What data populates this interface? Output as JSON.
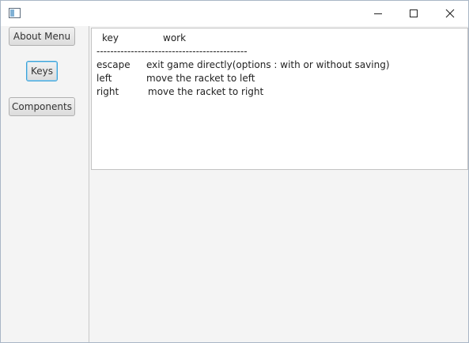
{
  "window": {
    "title": "",
    "controls": {
      "minimize_icon": "minimize-icon",
      "maximize_icon": "maximize-icon",
      "close_icon": "close-icon"
    }
  },
  "sidebar": {
    "buttons": [
      {
        "label": "About Menu"
      },
      {
        "label": "Keys",
        "focused": true
      },
      {
        "label": "Components"
      }
    ]
  },
  "content": {
    "header": {
      "key": "key",
      "work": "work"
    },
    "separator": "--------------------------------------------",
    "rows": [
      {
        "key": "escape",
        "work": "exit game directly(options : with or without saving)"
      },
      {
        "key": "left",
        "work": "move the racket to left"
      },
      {
        "key": "right",
        "work": "move the racket to right"
      }
    ]
  },
  "colors": {
    "focus_border": "#3aa2d8",
    "window_bg": "#f4f4f4",
    "text_area_bg": "#ffffff"
  }
}
